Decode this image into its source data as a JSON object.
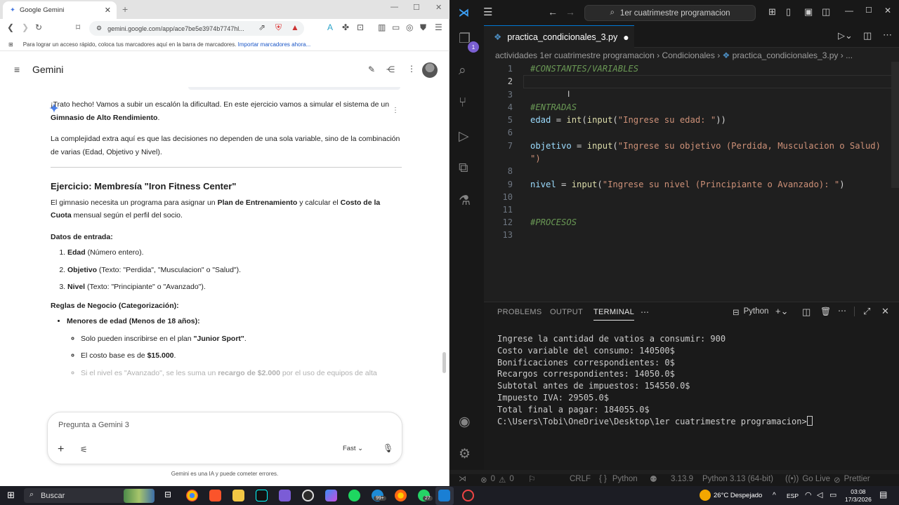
{
  "chrome": {
    "tab_title": "Google Gemini",
    "url": "gemini.google.com/app/ace7be5e3974b7747hl...",
    "bookmarks_hint": "Para lograr un acceso rápido, coloca tus marcadores aquí en la barra de marcadores.",
    "bookmarks_link": "Importar marcadores ahora..."
  },
  "gemini": {
    "title": "Gemini",
    "intro1_a": "¡Trato hecho! Vamos a subir un escalón la dificultad. En este ejercicio vamos a simular el sistema de un ",
    "intro1_b": "Gimnasio de Alto Rendimiento",
    "intro1_c": ".",
    "intro2": "La complejidad extra aquí es que las decisiones no dependen de una sola variable, sino de la combinación de varias (Edad, Objetivo y Nivel).",
    "heading": "Ejercicio: Membresía \"Iron Fitness Center\"",
    "desc_a": "El gimnasio necesita un programa para asignar un ",
    "desc_b": "Plan de Entrenamiento",
    "desc_c": " y calcular el ",
    "desc_d": "Costo de la Cuota",
    "desc_e": " mensual según el perfil del socio.",
    "inputs_heading": "Datos de entrada:",
    "inputs": [
      {
        "name": "Edad",
        "detail": " (Número entero)."
      },
      {
        "name": "Objetivo",
        "detail": " (Texto: \"Perdida\", \"Musculacion\" o \"Salud\")."
      },
      {
        "name": "Nivel",
        "detail": " (Texto: \"Principiante\" o \"Avanzado\")."
      }
    ],
    "rules_heading": "Reglas de Negocio (Categorización):",
    "rule1": "Menores de edad (Menos de 18 años):",
    "rule1_sub1_a": "Solo pueden inscribirse en el plan ",
    "rule1_sub1_b": "\"Junior Sport\"",
    "rule1_sub1_c": ".",
    "rule1_sub2_a": "El costo base es de ",
    "rule1_sub2_b": "$15.000",
    "rule1_sub2_c": ".",
    "rule1_sub3_a": "Si el nivel es \"Avanzado\", se les suma un ",
    "rule1_sub3_b": "recargo de $2.000",
    "rule1_sub3_c": " por el uso de equipos de alta",
    "input_placeholder": "Pregunta a Gemini 3",
    "mode": "Fast",
    "disclaimer": "Gemini es una IA y puede cometer errores."
  },
  "vscode": {
    "search": "1er cuatrimestre programacion",
    "badge": "1",
    "tab": "practica_condicionales_3.py",
    "breadcrumb": [
      "actividades 1er cuatrimestre programacion",
      "Condicionales",
      "practica_condicionales_3.py",
      "..."
    ],
    "lines": [
      {
        "n": "1",
        "text": "#CONSTANTES/VARIABLES"
      },
      {
        "n": "2",
        "text": ""
      },
      {
        "n": "3",
        "text": ""
      },
      {
        "n": "4",
        "text": "#ENTRADAS"
      },
      {
        "n": "5",
        "text": "edad = int(input(\"Ingrese su edad: \"))"
      },
      {
        "n": "6",
        "text": ""
      },
      {
        "n": "7",
        "text": "objetivo = input(\"Ingrese su objetivo (Perdida, Musculacion o Salud)"
      },
      {
        "n": "",
        "text": "\")"
      },
      {
        "n": "8",
        "text": ""
      },
      {
        "n": "9",
        "text": "nivel = input(\"Ingrese su nivel (Principiante o Avanzado): \")"
      },
      {
        "n": "10",
        "text": ""
      },
      {
        "n": "11",
        "text": ""
      },
      {
        "n": "12",
        "text": "#PROCESOS"
      },
      {
        "n": "13",
        "text": ""
      }
    ],
    "panel_tabs": [
      "PROBLEMS",
      "OUTPUT",
      "TERMINAL"
    ],
    "shell": "Python",
    "terminal": [
      "Ingrese la cantidad de vatios a consumir: 900",
      "Costo variable del consumo: 140500$",
      "Bonificaciones correspondientes: 0$",
      "Recargos correspondientes: 14050.0$",
      "Subtotal antes de impuestos: 154550.0$",
      "Impuesto IVA: 29505.0$",
      "Total final a pagar: 184055.0$",
      "",
      "C:\\Users\\Tobi\\OneDrive\\Desktop\\1er cuatrimestre programacion>"
    ],
    "status": {
      "errors": "0",
      "warnings": "0",
      "eol": "CRLF",
      "lang": "Python",
      "version": "3.13.9",
      "interpreter": "Python 3.13 (64-bit)",
      "golive": "Go Live",
      "prettier": "Prettier"
    }
  },
  "taskbar": {
    "search": "Buscar",
    "weather": "26°C Despejado",
    "lang": "ESP",
    "time": "03:08",
    "date": "17/3/2026",
    "notif_count_1": "99+",
    "notif_count_2": "27"
  }
}
